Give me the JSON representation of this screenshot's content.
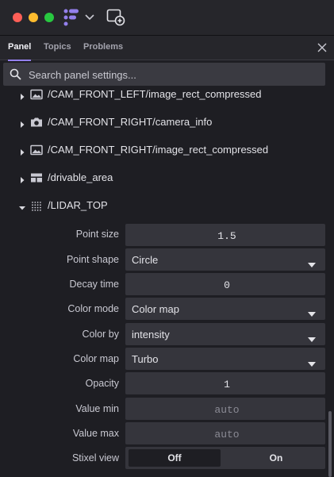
{
  "tabs": [
    {
      "label": "Panel"
    },
    {
      "label": "Topics"
    },
    {
      "label": "Problems"
    }
  ],
  "search": {
    "placeholder": "Search panel settings..."
  },
  "topics": [
    {
      "label": "/CAM_FRONT_LEFT/image_rect_compressed",
      "icon": "image-icon",
      "expanded": false
    },
    {
      "label": "/CAM_FRONT_RIGHT/camera_info",
      "icon": "camera-icon",
      "expanded": false
    },
    {
      "label": "/CAM_FRONT_RIGHT/image_rect_compressed",
      "icon": "image-icon",
      "expanded": false
    },
    {
      "label": "/drivable_area",
      "icon": "grid-map-icon",
      "expanded": false
    },
    {
      "label": "/LIDAR_TOP",
      "icon": "point-cloud-icon",
      "expanded": true
    }
  ],
  "fields": {
    "point_size": {
      "label": "Point size",
      "value": "1.5"
    },
    "point_shape": {
      "label": "Point shape",
      "value": "Circle"
    },
    "decay_time": {
      "label": "Decay time",
      "value": "0"
    },
    "color_mode": {
      "label": "Color mode",
      "value": "Color map"
    },
    "color_by": {
      "label": "Color by",
      "value": "intensity"
    },
    "color_map": {
      "label": "Color map",
      "value": "Turbo"
    },
    "opacity": {
      "label": "Opacity",
      "value": "1"
    },
    "value_min": {
      "label": "Value min",
      "placeholder": "auto"
    },
    "value_max": {
      "label": "Value max",
      "placeholder": "auto"
    },
    "stixel_view": {
      "label": "Stixel view",
      "off_label": "Off",
      "on_label": "On",
      "selected": "Off"
    }
  },
  "colors": {
    "accent": "#9480ed",
    "background": "#1e1e23",
    "input": "#35353c"
  }
}
